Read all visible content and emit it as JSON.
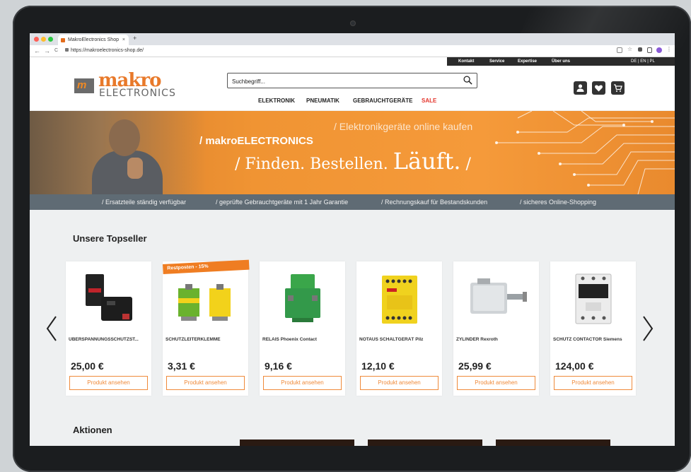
{
  "browser": {
    "tab_title": "MakroElectronics Shop",
    "tab_close": "×",
    "new_tab": "+",
    "url": "https://makroelectronics-shop.de/",
    "back": "←",
    "forward": "→",
    "reload": "C"
  },
  "topbar": {
    "links": [
      "Kontakt",
      "Service",
      "Expertise",
      "Über uns"
    ],
    "languages": "DE | EN | PL"
  },
  "header": {
    "logo_name": "makro",
    "logo_sub": "ELECTRONICS",
    "search_placeholder": "Suchbegriff...",
    "nav": [
      "ELEKTRONIK",
      "PNEUMATIK",
      "GEBRAUCHTGERÄTE",
      "SALE"
    ],
    "icons": [
      "account-icon",
      "heart-icon",
      "cart-icon"
    ]
  },
  "banner": {
    "top_line": "/ Elektronikgeräte online kaufen",
    "brand_line": "/ makroELECTRONICS",
    "slogan_a": "/ Finden. Bestellen.",
    "slogan_b": "Läuft.",
    "slogan_c": "/"
  },
  "usp": [
    "/ Ersatzteile ständig verfügbar",
    "/ geprüfte Gebrauchtgeräte mit 1 Jahr Garantie",
    "/ Rechnungskauf für Bestandskunden",
    "/ sicheres Online-Shopping"
  ],
  "topseller": {
    "title": "Unsere Topseller",
    "products": [
      {
        "name": "ÜBERSPANNUNGSSCHUTZST...",
        "price": "25,00 €",
        "button": "Produkt ansehen",
        "ribbon": ""
      },
      {
        "name": "SCHUTZLEITERKLEMME",
        "price": "3,31 €",
        "button": "Produkt ansehen",
        "ribbon": "Restposten - 15%"
      },
      {
        "name": "RELAIS Phoenix Contact",
        "price": "9,16 €",
        "button": "Produkt ansehen",
        "ribbon": ""
      },
      {
        "name": "NOTAUS SCHALTGERÄT Pilz",
        "price": "12,10 €",
        "button": "Produkt ansehen",
        "ribbon": ""
      },
      {
        "name": "ZYLINDER Rexroth",
        "price": "25,99 €",
        "button": "Produkt ansehen",
        "ribbon": ""
      },
      {
        "name": "SCHÜTZ CONTACTOR Siemens",
        "price": "124,00 €",
        "button": "Produkt ansehen",
        "ribbon": ""
      }
    ]
  },
  "aktionen": {
    "title": "Aktionen"
  },
  "colors": {
    "accent": "#ef7d22",
    "sale": "#e4342b",
    "usp_bar": "#5f6b74",
    "dark": "#2b2b2b"
  }
}
